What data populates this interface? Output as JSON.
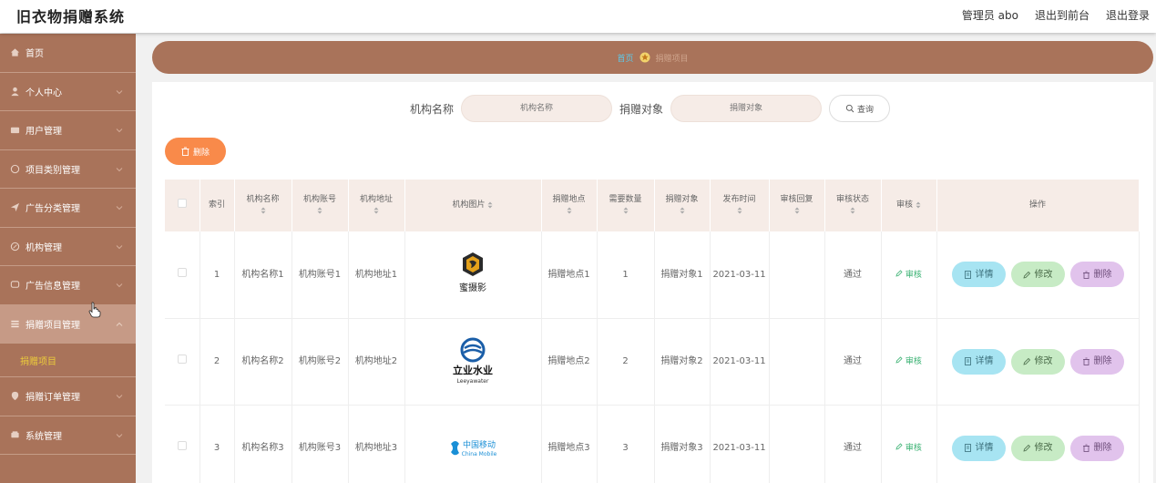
{
  "header": {
    "title": "旧衣物捐赠系统",
    "links": [
      "管理员 abo",
      "退出到前台",
      "退出登录"
    ]
  },
  "sidebar": {
    "items": [
      {
        "label": "首页",
        "icon": "home-icon"
      },
      {
        "label": "个人中心",
        "icon": "user-icon"
      },
      {
        "label": "用户管理",
        "icon": "users-icon"
      },
      {
        "label": "项目类别管理",
        "icon": "category-icon"
      },
      {
        "label": "广告分类管理",
        "icon": "send-icon"
      },
      {
        "label": "机构管理",
        "icon": "org-icon"
      },
      {
        "label": "广告信息管理",
        "icon": "chat-icon"
      },
      {
        "label": "捐赠项目管理",
        "icon": "list-icon"
      },
      {
        "label": "捐赠订单管理",
        "icon": "location-icon"
      },
      {
        "label": "系统管理",
        "icon": "system-icon"
      }
    ],
    "sub_item": "捐赠项目"
  },
  "breadcrumb": {
    "home": "首页",
    "current": "捐赠项目"
  },
  "search": {
    "label1": "机构名称",
    "placeholder1": "机构名称",
    "label2": "捐赠对象",
    "placeholder2": "捐赠对象",
    "button": "查询"
  },
  "toolbar": {
    "delete_label": "删除"
  },
  "table": {
    "headers": [
      "索引",
      "机构名称",
      "机构账号",
      "机构地址",
      "机构图片",
      "捐赠地点",
      "需要数量",
      "捐赠对象",
      "发布时间",
      "审核回复",
      "审核状态",
      "审核",
      "操作"
    ],
    "rows": [
      {
        "index": "1",
        "name": "机构名称1",
        "account": "机构账号1",
        "address": "机构地址1",
        "place": "捐赠地点1",
        "qty": "1",
        "target": "捐赠对象1",
        "date": "2021-03-11",
        "reply": "",
        "status": "通过",
        "logo_text": "蜜摄影"
      },
      {
        "index": "2",
        "name": "机构名称2",
        "account": "机构账号2",
        "address": "机构地址2",
        "place": "捐赠地点2",
        "qty": "2",
        "target": "捐赠对象2",
        "date": "2021-03-11",
        "reply": "",
        "status": "通过",
        "logo_text": "立业水业",
        "logo_sub": "Leeyawater"
      },
      {
        "index": "3",
        "name": "机构名称3",
        "account": "机构账号3",
        "address": "机构地址3",
        "place": "捐赠地点3",
        "qty": "3",
        "target": "捐赠对象3",
        "date": "2021-03-11",
        "reply": "",
        "status": "通过",
        "logo_text": "中国移动",
        "logo_sub": "China Mobile"
      }
    ],
    "audit_label": "审核",
    "ops": {
      "detail": "详情",
      "edit": "修改",
      "delete": "删除"
    }
  },
  "colors": {
    "sidebar": "#a9735a",
    "active_sub": "#eccb3b",
    "delete_button": "#f98a4a",
    "detail_button": "#a7e4f2",
    "edit_button": "#c7ebc5",
    "delete_row_button": "#e1c3ec"
  }
}
